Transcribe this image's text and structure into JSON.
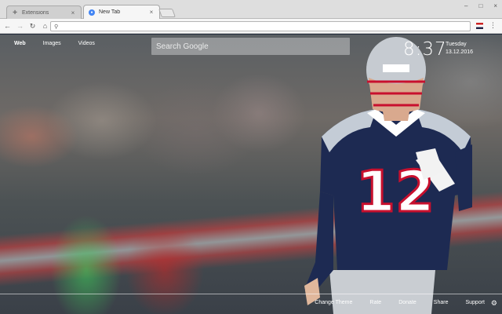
{
  "tabs": [
    {
      "label": "Extensions",
      "icon": "puzzle-icon",
      "active": false
    },
    {
      "label": "New Tab",
      "icon": "chrome-icon",
      "active": true
    }
  ],
  "omnibox": {
    "value": ""
  },
  "nav": {
    "items": [
      "Web",
      "Images",
      "Videos"
    ],
    "active": "Web"
  },
  "search": {
    "placeholder": "Search Google"
  },
  "clock": {
    "time": "8:37",
    "weekday": "Tuesday",
    "date": "13.12.2016"
  },
  "footer": {
    "links": [
      "Change Theme",
      "Rate",
      "Donate",
      "Share",
      "Support"
    ]
  },
  "jersey": {
    "number": "12"
  }
}
